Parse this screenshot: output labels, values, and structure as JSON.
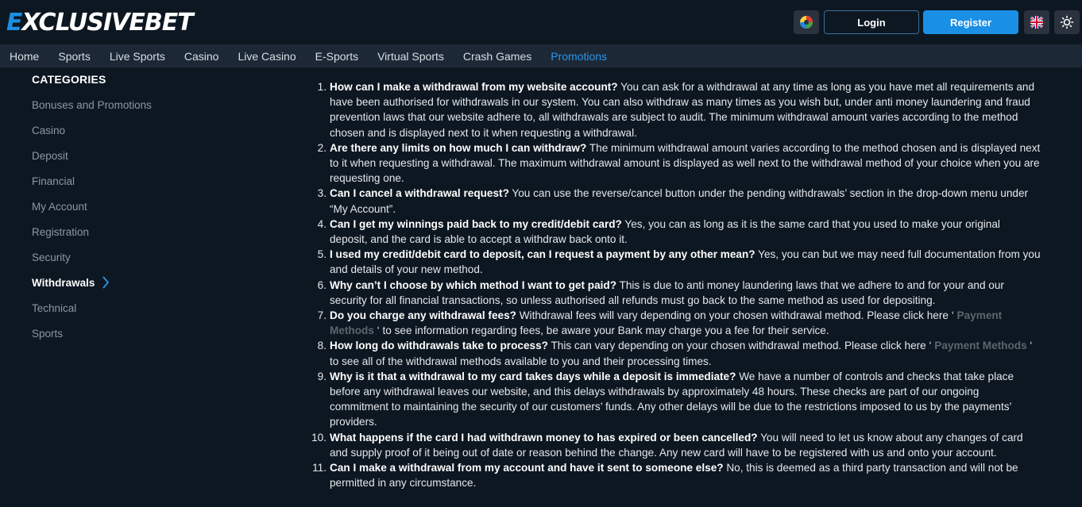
{
  "brand": {
    "logo_mark": "E",
    "logo_text": "XCLUSIVEBET"
  },
  "header": {
    "login": "Login",
    "register": "Register",
    "icons": [
      "wheel-icon",
      "uk-flag-icon",
      "sun-icon"
    ],
    "colors": {
      "primary": "#1a8fe6",
      "background": "#0d1721",
      "nav": "#1c2836"
    }
  },
  "nav": {
    "items": [
      "Home",
      "Sports",
      "Live Sports",
      "Casino",
      "Live Casino",
      "E-Sports",
      "Virtual Sports",
      "Crash Games",
      "Promotions"
    ],
    "active": "Promotions"
  },
  "sidebar": {
    "title": "CATEGORIES",
    "items": [
      "Bonuses and Promotions",
      "Casino",
      "Deposit",
      "Financial",
      "My Account",
      "Registration",
      "Security",
      "Withdrawals",
      "Technical",
      "Sports"
    ],
    "active": "Withdrawals"
  },
  "faq": [
    {
      "n": "1.",
      "q": "How can I make a withdrawal from my website account?",
      "a": " You can ask for a withdrawal at any time as long as you have met all requirements and have been authorised for withdrawals in our system. You can also withdraw as many times as you wish but, under anti money laundering and fraud prevention laws that our website adhere to, all withdrawals are subject to audit. The minimum withdrawal amount varies according to the method chosen and is displayed next to it when requesting a withdrawal."
    },
    {
      "n": "2.",
      "q": "Are there any limits on how much I can withdraw?",
      "a": " The minimum withdrawal amount varies according to the method chosen and is displayed next to it when requesting a withdrawal. The maximum withdrawal amount is displayed as well next to the withdrawal method of your choice when you are requesting one."
    },
    {
      "n": "3.",
      "q": "Can I cancel a withdrawal request?",
      "a": " You can use the reverse/cancel button under the pending withdrawals’ section in the drop-down menu under “My Account”."
    },
    {
      "n": "4.",
      "q": "Can I get my winnings paid back to my credit/debit card?",
      "a": " Yes, you can as long as it is the same card that you used to make your original deposit, and the card is able to accept a withdraw back onto it."
    },
    {
      "n": "5.",
      "q": "I used my credit/debit card to deposit, can I request a payment by any other mean?",
      "a": " Yes, you can but we may need full documentation from you and details of your new method."
    },
    {
      "n": "6.",
      "q": "Why can’t I choose by which method I want to get paid?",
      "a": " This is due to anti money laundering laws that we adhere to and for your and our security for all financial transactions, so unless authorised all refunds must go back to the same method as used for depositing."
    },
    {
      "n": "7.",
      "q": "Do you charge any withdrawal fees?",
      "a": " Withdrawal fees will vary depending on your chosen withdrawal method. Please click here ‘",
      "link": " Payment Methods ",
      "a2": "‘ to see information regarding fees, be aware your Bank may charge you a fee for their service."
    },
    {
      "n": "8.",
      "q": "How long do withdrawals take to process?",
      "a": " This can vary depending on your chosen withdrawal method. Please click here ‘",
      "link": " Payment Methods ",
      "a2": "‘ to see all of the withdrawal methods available to you and their processing times."
    },
    {
      "n": "9.",
      "q": "Why is it that a withdrawal to my card takes days while a deposit is immediate?",
      "a": " We have a number of controls and checks that take place before any withdrawal leaves our website, and this delays withdrawals by approximately 48 hours. These checks are part of our ongoing commitment to maintaining the security of our customers’ funds. Any other delays will be due to the restrictions imposed to us by the payments’ providers."
    },
    {
      "n": "10.",
      "q": "What happens if the card I had withdrawn money to has expired or been cancelled?",
      "a": " You will need to let us know about any changes of card and supply proof of it being out of date or reason behind the change. Any new card will have to be registered with us and onto your account."
    },
    {
      "n": "11.",
      "q": "Can I make a withdrawal from my account and have it sent to someone else?",
      "a": " No, this is deemed as a third party transaction and will not be permitted in any circumstance."
    }
  ]
}
